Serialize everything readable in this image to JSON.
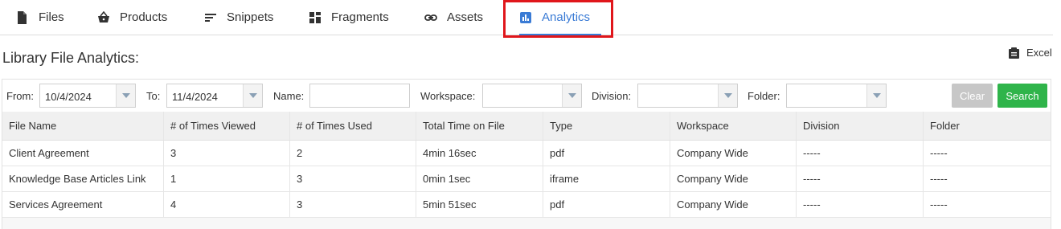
{
  "tabs": [
    {
      "label": "Files",
      "icon": "file-icon"
    },
    {
      "label": "Products",
      "icon": "basket-icon"
    },
    {
      "label": "Snippets",
      "icon": "snippets-icon"
    },
    {
      "label": "Fragments",
      "icon": "fragments-icon"
    },
    {
      "label": "Assets",
      "icon": "link-icon"
    },
    {
      "label": "Analytics",
      "icon": "analytics-icon",
      "active": true
    }
  ],
  "page_title": "Library File Analytics:",
  "export": {
    "label": "Excel",
    "icon": "clipboard-icon"
  },
  "filters": {
    "from_label": "From:",
    "from_value": "10/4/2024",
    "to_label": "To:",
    "to_value": "11/4/2024",
    "name_label": "Name:",
    "name_value": "",
    "workspace_label": "Workspace:",
    "workspace_value": "",
    "division_label": "Division:",
    "division_value": "",
    "folder_label": "Folder:",
    "folder_value": "",
    "clear_label": "Clear",
    "search_label": "Search"
  },
  "table": {
    "columns": [
      "File Name",
      "# of Times Viewed",
      "# of Times Used",
      "Total Time on File",
      "Type",
      "Workspace",
      "Division",
      "Folder"
    ],
    "rows": [
      [
        "Client Agreement",
        "3",
        "2",
        "4min 16sec",
        "pdf",
        "Company Wide",
        "-----",
        "-----"
      ],
      [
        "Knowledge Base Articles Link",
        "1",
        "3",
        "0min 1sec",
        "iframe",
        "Company Wide",
        "-----",
        "-----"
      ],
      [
        "Services Agreement",
        "4",
        "3",
        "5min 51sec",
        "pdf",
        "Company Wide",
        "-----",
        "-----"
      ]
    ]
  },
  "colors": {
    "accent": "#3a7bd5",
    "highlight": "#e0161b",
    "search": "#2fb44a",
    "clear": "#c7c7c7"
  }
}
